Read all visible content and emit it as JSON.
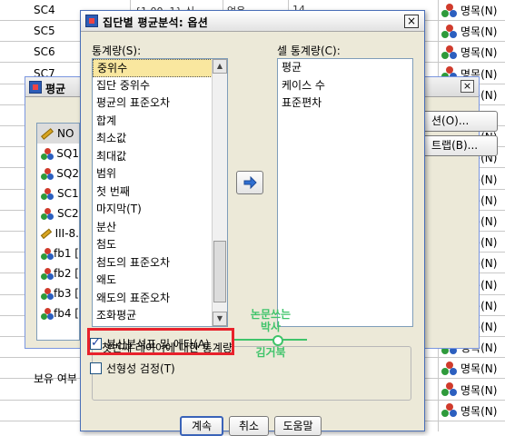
{
  "sheet": {
    "rows": [
      {
        "var": "SC4",
        "values": "{1.00, 1} 신...",
        "missing": "없음",
        "num": "14",
        "measure": "명목(N)"
      },
      {
        "var": "SC5",
        "values": "",
        "missing": "",
        "num": "",
        "measure": "명목(N)"
      },
      {
        "var": "SC6",
        "values": "",
        "missing": "",
        "num": "",
        "measure": "명목(N)"
      },
      {
        "var": "SC7",
        "values": "",
        "missing": "",
        "num": "",
        "measure": "명목(N)"
      },
      {
        "var": "",
        "values": "",
        "missing": "",
        "num": "",
        "measure": "명목(N)"
      },
      {
        "var": "",
        "values": "",
        "missing": "",
        "num": "",
        "measure": "(S)"
      },
      {
        "var": "",
        "values": "",
        "missing": "",
        "num": "",
        "measure": "명목(N)"
      },
      {
        "var": "",
        "values": "",
        "missing": "",
        "num": "",
        "measure": "명목(N)"
      },
      {
        "var": "",
        "values": "",
        "missing": "",
        "num": "",
        "measure": "명목(N)"
      },
      {
        "var": "",
        "values": "",
        "missing": "",
        "num": "",
        "measure": "명목(N)"
      },
      {
        "var": "",
        "values": "",
        "missing": "",
        "num": "",
        "measure": "명목(N)"
      },
      {
        "var": "",
        "values": "",
        "missing": "",
        "num": "",
        "measure": "명목(N)"
      },
      {
        "var": "",
        "values": "",
        "missing": "",
        "num": "",
        "measure": "명목(N)"
      },
      {
        "var": "",
        "values": "",
        "missing": "",
        "num": "",
        "measure": "명목(N)"
      },
      {
        "var": "",
        "values": "",
        "missing": "",
        "num": "",
        "measure": "명목(N)"
      },
      {
        "var": "",
        "values": "",
        "missing": "",
        "num": "",
        "measure": "명목(N)"
      },
      {
        "var": "",
        "values": "",
        "missing": "",
        "num": "",
        "measure": "명목(N)"
      },
      {
        "var": "",
        "values": "",
        "missing": "",
        "num": "",
        "measure": "명목(N)"
      },
      {
        "var": "",
        "values": "",
        "missing": "",
        "num": "",
        "measure": "명목(N)"
      },
      {
        "var": "",
        "values": "",
        "missing": "",
        "num": "",
        "measure": "명목(N)"
      }
    ],
    "bottom_label": "보유 여부"
  },
  "back_dialog": {
    "title": "평균",
    "close": "×",
    "variables": [
      {
        "name": "NO",
        "type": "scale"
      },
      {
        "name": "SQ1",
        "type": "nominal"
      },
      {
        "name": "SQ2",
        "type": "nominal"
      },
      {
        "name": "SC1",
        "type": "nominal"
      },
      {
        "name": "SC2",
        "type": "nominal"
      },
      {
        "name": "III-8.",
        "type": "scale"
      },
      {
        "name": "fb1 [",
        "type": "nominal"
      },
      {
        "name": "fb2 [",
        "type": "nominal"
      },
      {
        "name": "fb3 [",
        "type": "nominal"
      },
      {
        "name": "fb4 [",
        "type": "nominal"
      }
    ],
    "buttons": [
      "션(O)...",
      "트랩(B)..."
    ]
  },
  "dialog": {
    "title": "집단별 평균분석: 옵션",
    "close": "×",
    "stats_label": "통계량(S):",
    "cell_stats_label": "셀 통계량(C):",
    "stats": [
      "중위수",
      "집단 중위수",
      "평균의 표준오차",
      "합계",
      "최소값",
      "최대값",
      "범위",
      "첫 번째",
      "마지막(T)",
      "분산",
      "첨도",
      "첨도의 표준오차",
      "왜도",
      "왜도의 표준오차",
      "조화평균"
    ],
    "selected_stat": 0,
    "cell_stats": [
      "평균",
      "케이스 수",
      "표준편차"
    ],
    "move_button": "➔",
    "group_title": "첫번째 레이어에 대한 통계량",
    "anova": {
      "label": "분산분석표 및 에타(A)",
      "checked": true
    },
    "linearity": {
      "label": "선형성 검정(T)",
      "checked": false
    },
    "buttons": {
      "continue": "계속",
      "cancel": "취소",
      "help": "도움말"
    }
  },
  "watermark": {
    "line1": "논문쓰는",
    "line2": "박사",
    "line3": "김거북"
  },
  "colors": {
    "highlight": "#e8212b",
    "watermark": "#3fc46a",
    "accent": "#3a63b8"
  }
}
